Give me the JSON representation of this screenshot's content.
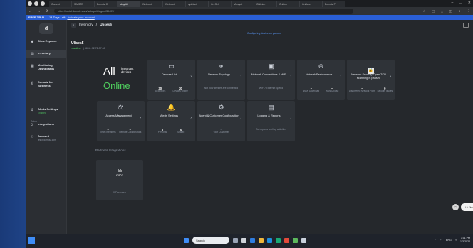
{
  "browser": {
    "tabs": [
      "Content",
      "SIMSTE",
      "Domotz C",
      "ubiquiti",
      "Webroot ",
      "Webroot",
      "sydXnet",
      "On Gel",
      "Mongolt",
      "Oblivion",
      "OnMerr",
      "OnHere",
      "Domotz P"
    ],
    "url": "https://portal.domotz.com/webapp/#/agent/39407/",
    "window_controls": [
      "–",
      "❐",
      "✕"
    ]
  },
  "trial": {
    "label": "FREE TRIAL",
    "days": "- 14 Days Left",
    "link": "Activate your account"
  },
  "sidebar": {
    "logo": "d",
    "items": [
      {
        "label": "Sites Explorer",
        "icon": "◉"
      },
      {
        "label": "Inventory",
        "icon": "▤"
      },
      {
        "label": "Monitoring Dashboards",
        "icon": "▦"
      },
      {
        "label": "Domotz for Business",
        "icon": "◍"
      }
    ],
    "section": "Setup",
    "setup_items": [
      {
        "label": "Alerts Settings",
        "sub": "Enabled",
        "icon": "⚙"
      },
      {
        "label": "Integrations",
        "icon": "⟳"
      },
      {
        "label": "Account",
        "sub": "test@domotz.com",
        "icon": "⚇"
      }
    ]
  },
  "main": {
    "breadcrumb": {
      "parent": "Inventory",
      "sep": "/",
      "current": "Ulises5"
    },
    "notice": "Configuring device on patrons",
    "site_name": "Ulises5",
    "status_online": "● online",
    "status_ip": "| 88.41.72.72:07:08",
    "all": {
      "big": "All",
      "important": "important devices",
      "online": "Online"
    },
    "tiles": [
      {
        "id": "devices",
        "icon": "▭",
        "title": "Devices List",
        "stats": [
          {
            "v": "30",
            "l": "All devices"
          },
          {
            "v": "30",
            "l": "Devices Online"
          }
        ]
      },
      {
        "id": "topology",
        "icon": "⚭",
        "title": "Network Topology",
        "msg": "Not how devices are connected"
      },
      {
        "id": "connections",
        "icon": "▣",
        "title": "Network Connections & WiFi",
        "msg": "WiFi / Ethernet Speed"
      },
      {
        "id": "performance",
        "icon": "⊕",
        "title": "Network Performance",
        "stats": [
          {
            "v": "–",
            "l": "WAN Download"
          },
          {
            "v": "–",
            "l": "WAN Upload"
          }
        ]
      },
      {
        "id": "security",
        "icon": "🔒",
        "title": "Network Security Open TCP scanning is paused",
        "stats": [
          {
            "v": "–",
            "l": "Discovered Network Ports"
          },
          {
            "v": "0",
            "l": "Security Issues"
          }
        ]
      },
      {
        "id": "access",
        "icon": "⚖",
        "title": "Access Management",
        "stats": [
          {
            "v": "–",
            "l": "Team members"
          },
          {
            "v": "–",
            "l": "Remote Collaborators"
          }
        ]
      },
      {
        "id": "alerts",
        "icon": "🔔",
        "title": "Alerts Settings",
        "stats": [
          {
            "v": "0",
            "l": "Personal"
          },
          {
            "v": "0",
            "l": "Shared"
          }
        ]
      },
      {
        "id": "agent",
        "icon": "⚙",
        "title": "Agent & Customer Configuration",
        "msg": "–\nYour Customer"
      },
      {
        "id": "logging",
        "icon": "▤",
        "title": "Logging & Reports",
        "msg": "Get reports and log activities"
      }
    ],
    "partners_title": "Partners Integrations",
    "partner": {
      "logo_bars": "ılıılı",
      "name": "cisco",
      "foot": "0 Devices   ›"
    }
  },
  "help": {
    "bubble": "Hi. Need any help?",
    "close": "×"
  },
  "taskbar": {
    "search": "Search",
    "lang": "ENG",
    "time": "3:11 PM",
    "date": "1/3/2024"
  }
}
